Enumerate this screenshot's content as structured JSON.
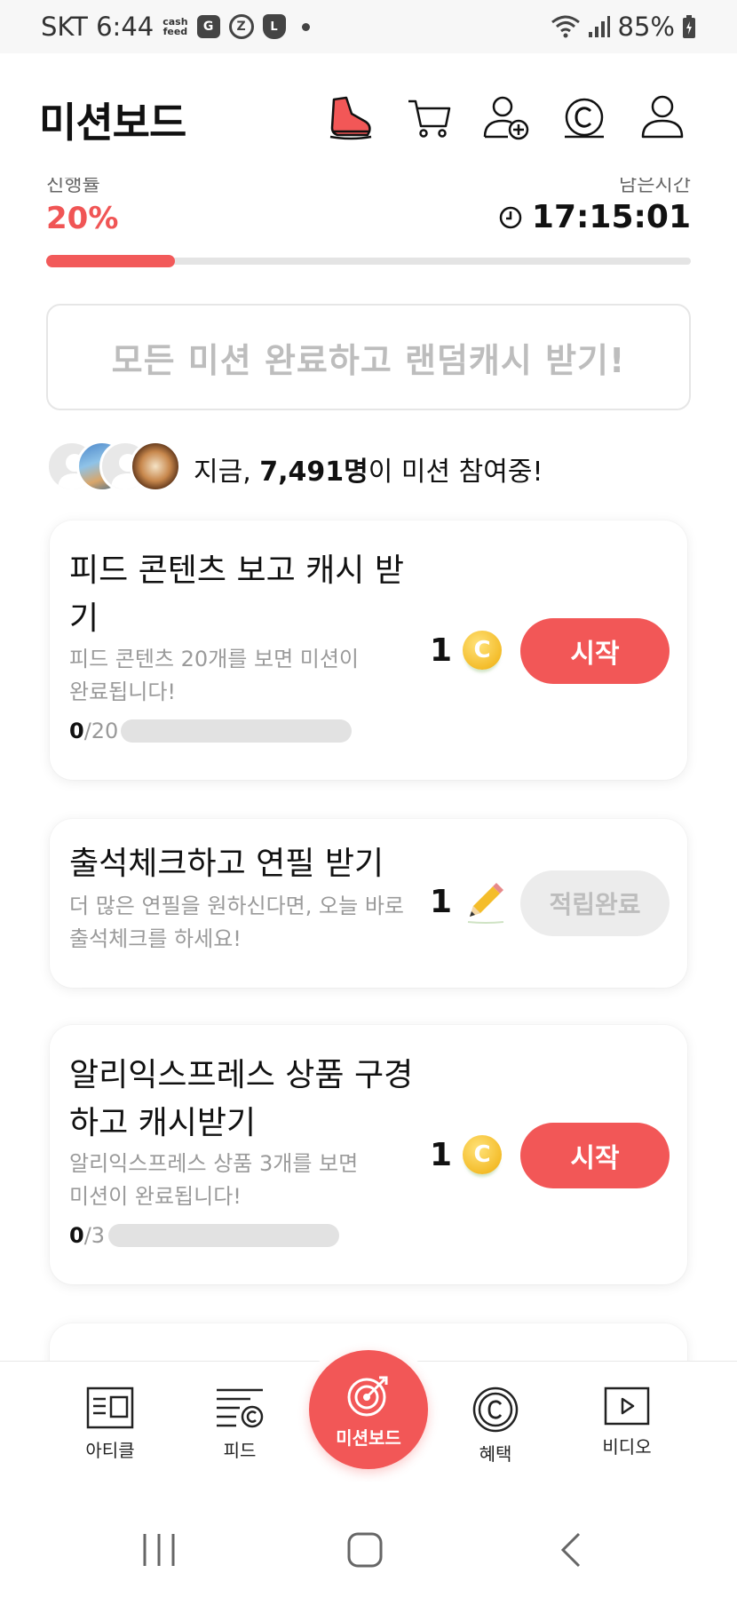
{
  "status_bar": {
    "carrier_time": "SKT 6:44",
    "cashfeed_line1": "cash",
    "cashfeed_line2": "feed",
    "badge_g": "G",
    "badge_z": "Z",
    "badge_l": "L",
    "battery": "85%"
  },
  "header": {
    "title": "미션보드"
  },
  "progress": {
    "label_left": "진행률",
    "label_right": "남은시간",
    "percent_text": "20%",
    "percent_value": 0.2,
    "timer": "17:15:01"
  },
  "banner": {
    "text": "모든 미션 완료하고 랜덤캐시 받기!"
  },
  "participants": {
    "prefix": "지금, ",
    "count": "7,491명",
    "suffix": "이 미션 참여중!"
  },
  "missions": [
    {
      "title": "피드 콘텐츠 보고 캐시 받기",
      "desc": "피드 콘텐츠 20개를 보면 미션이 완료됩니다!",
      "progress_current": "0",
      "progress_total": "/20",
      "progress_value": 0,
      "reward": "1",
      "reward_icon": "coin-icon",
      "coin_glyph": "C",
      "button": "시작"
    },
    {
      "title": "출석체크하고 연필 받기",
      "desc": "더 많은 연필을 원하신다면, 오늘 바로 출석체크를 하세요!",
      "reward": "1",
      "reward_icon": "pencil-icon",
      "button": "적립완료"
    },
    {
      "title": "알리익스프레스 상품 구경하고 캐시받기",
      "desc": "알리익스프레스 상품 3개를 보면 미션이 완료됩니다!",
      "progress_current": "0",
      "progress_total": "/3",
      "progress_value": 0,
      "reward": "1",
      "reward_icon": "coin-icon",
      "coin_glyph": "C",
      "button": "시작"
    }
  ],
  "bottom_nav": {
    "article": "아티클",
    "feed": "피드",
    "missionboard": "미션보드",
    "benefits": "혜택",
    "video": "비디오"
  },
  "colors": {
    "accent": "#f25757",
    "coin": "#f4bd2b",
    "muted": "#bdbdbd"
  }
}
